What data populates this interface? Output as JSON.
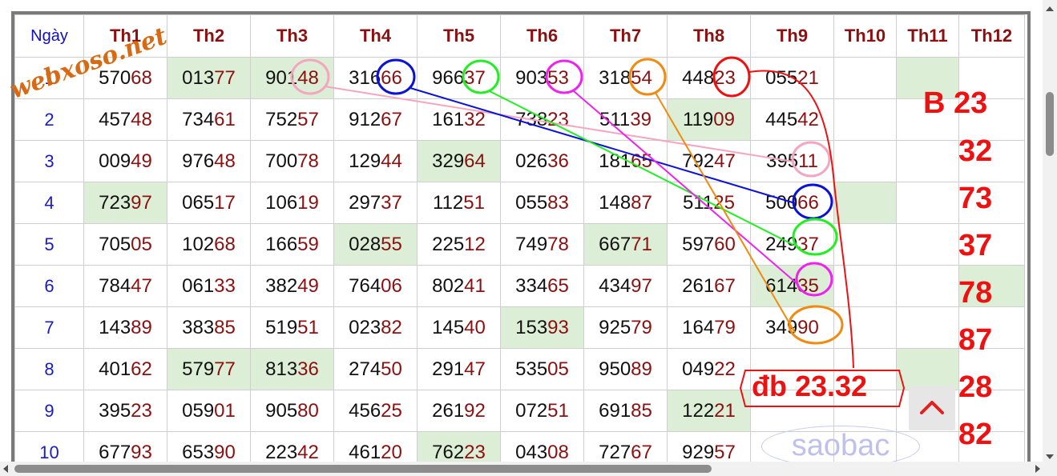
{
  "watermark": "webxoso.net",
  "header": {
    "day_label": "Ngày",
    "columns": [
      "Th1",
      "Th2",
      "Th3",
      "Th4",
      "Th5",
      "Th6",
      "Th7",
      "Th8",
      "Th9",
      "Th10",
      "Th11",
      "Th12"
    ]
  },
  "rows": [
    {
      "day": "1",
      "cells": [
        "57068",
        "01377",
        "90148",
        "31666",
        "96637",
        "90353",
        "31854",
        "44823",
        "05521",
        "",
        "",
        ""
      ],
      "highlight": [
        false,
        true,
        true,
        false,
        false,
        false,
        false,
        false,
        false,
        false,
        true,
        false
      ]
    },
    {
      "day": "2",
      "cells": [
        "45748",
        "73461",
        "75257",
        "91267",
        "16132",
        "73823",
        "51139",
        "11909",
        "44542",
        "",
        "",
        ""
      ],
      "highlight": [
        false,
        false,
        false,
        false,
        false,
        false,
        false,
        true,
        false,
        false,
        false,
        false
      ]
    },
    {
      "day": "3",
      "cells": [
        "00949",
        "97648",
        "70078",
        "12944",
        "32964",
        "02636",
        "18165",
        "79247",
        "39511",
        "",
        "",
        ""
      ],
      "highlight": [
        false,
        false,
        false,
        false,
        true,
        false,
        false,
        false,
        false,
        false,
        false,
        false
      ]
    },
    {
      "day": "4",
      "cells": [
        "72397",
        "06517",
        "10619",
        "29737",
        "11251",
        "05583",
        "14887",
        "51125",
        "50066",
        "",
        "",
        ""
      ],
      "highlight": [
        true,
        false,
        false,
        false,
        false,
        false,
        false,
        false,
        false,
        true,
        false,
        false
      ]
    },
    {
      "day": "5",
      "cells": [
        "70505",
        "10268",
        "16659",
        "02855",
        "22512",
        "74978",
        "66771",
        "59760",
        "24937",
        "",
        "",
        ""
      ],
      "highlight": [
        false,
        false,
        false,
        true,
        false,
        false,
        true,
        false,
        false,
        false,
        false,
        false
      ]
    },
    {
      "day": "6",
      "cells": [
        "78447",
        "06133",
        "38249",
        "76406",
        "80241",
        "33465",
        "43497",
        "26167",
        "61435",
        "",
        "",
        ""
      ],
      "highlight": [
        false,
        false,
        false,
        false,
        false,
        false,
        false,
        false,
        true,
        false,
        false,
        true
      ]
    },
    {
      "day": "7",
      "cells": [
        "14389",
        "38385",
        "51951",
        "02382",
        "14540",
        "15393",
        "92579",
        "16479",
        "34990",
        "",
        "",
        ""
      ],
      "highlight": [
        false,
        false,
        false,
        false,
        false,
        true,
        false,
        false,
        false,
        false,
        false,
        false
      ]
    },
    {
      "day": "8",
      "cells": [
        "40162",
        "57977",
        "81336",
        "27450",
        "29147",
        "53505",
        "95089",
        "04922",
        "",
        "",
        "",
        ""
      ],
      "highlight": [
        false,
        true,
        true,
        false,
        false,
        false,
        false,
        false,
        false,
        false,
        true,
        false
      ]
    },
    {
      "day": "9",
      "cells": [
        "39523",
        "05901",
        "90580",
        "45625",
        "26192",
        "07251",
        "69185",
        "12221",
        "",
        "",
        "",
        ""
      ],
      "highlight": [
        false,
        false,
        false,
        false,
        false,
        false,
        false,
        true,
        false,
        false,
        false,
        false
      ]
    },
    {
      "day": "10",
      "cells": [
        "67793",
        "65390",
        "22342",
        "46120",
        "76223",
        "04308",
        "72767",
        "92957",
        "",
        "",
        "",
        ""
      ],
      "highlight": [
        false,
        false,
        false,
        false,
        true,
        false,
        false,
        false,
        false,
        false,
        false,
        false
      ]
    }
  ],
  "annotations": {
    "b_label": "B 23",
    "b_numbers": [
      "32",
      "73",
      "37",
      "78",
      "87",
      "28",
      "82"
    ],
    "db_label": "đb 23.32",
    "saobac": "saobac"
  },
  "colors": {
    "pink": "#f4a6c0",
    "blue": "#0b12d8",
    "green": "#22ee22",
    "magenta": "#ee22ee",
    "orange": "#f08a10",
    "red": "#ee1111",
    "highlight": "#dcefd6",
    "tail": "#8b1010"
  }
}
